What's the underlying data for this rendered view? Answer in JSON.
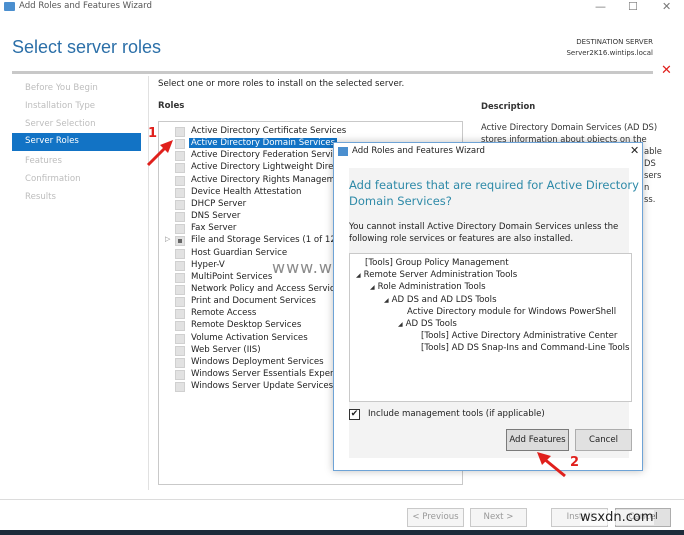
{
  "window": {
    "title": "Add Roles and Features Wizard",
    "minimize": "—",
    "maximize": "☐",
    "close": "✕"
  },
  "header": {
    "title": "Select server roles",
    "dest_label": "DESTINATION SERVER",
    "dest_server": "Server2K16.wintips.local",
    "error_icon": "✕"
  },
  "nav": {
    "items": [
      "Before You Begin",
      "Installation Type",
      "Server Selection",
      "Server Roles",
      "Features",
      "Confirmation",
      "Results"
    ],
    "selected": "Server Roles"
  },
  "main": {
    "instruction": "Select one or more roles to install on the selected server.",
    "roles_label": "Roles",
    "description_label": "Description",
    "description_lines": [
      "Active Directory Domain Services (AD DS)",
      "stores information about objects on the"
    ],
    "description_fragments": [
      "able",
      "DS",
      "sers",
      "n",
      "ss."
    ],
    "roles": [
      {
        "label": "Active Directory Certificate Services",
        "state": "unchecked"
      },
      {
        "label": "Active Directory Domain Services",
        "state": "unchecked",
        "selected": true
      },
      {
        "label": "Active Directory Federation Services",
        "state": "unchecked"
      },
      {
        "label": "Active Directory Lightweight Directory Services",
        "state": "unchecked"
      },
      {
        "label": "Active Directory Rights Management Services",
        "state": "unchecked"
      },
      {
        "label": "Device Health Attestation",
        "state": "unchecked"
      },
      {
        "label": "DHCP Server",
        "state": "unchecked"
      },
      {
        "label": "DNS Server",
        "state": "unchecked"
      },
      {
        "label": "Fax Server",
        "state": "unchecked"
      },
      {
        "label": "File and Storage Services (1 of 12 installed)",
        "state": "partial",
        "expandable": true
      },
      {
        "label": "Host Guardian Service",
        "state": "unchecked"
      },
      {
        "label": "Hyper-V",
        "state": "unchecked"
      },
      {
        "label": "MultiPoint Services",
        "state": "unchecked"
      },
      {
        "label": "Network Policy and Access Services",
        "state": "unchecked"
      },
      {
        "label": "Print and Document Services",
        "state": "unchecked"
      },
      {
        "label": "Remote Access",
        "state": "unchecked"
      },
      {
        "label": "Remote Desktop Services",
        "state": "unchecked"
      },
      {
        "label": "Volume Activation Services",
        "state": "unchecked"
      },
      {
        "label": "Web Server (IIS)",
        "state": "unchecked"
      },
      {
        "label": "Windows Deployment Services",
        "state": "unchecked"
      },
      {
        "label": "Windows Server Essentials Experience",
        "state": "unchecked"
      },
      {
        "label": "Windows Server Update Services",
        "state": "unchecked"
      }
    ]
  },
  "dialog": {
    "title": "Add Roles and Features Wizard",
    "close": "✕",
    "heading": [
      "Add features that are required for Active Directory",
      "Domain Services?"
    ],
    "body": [
      "You cannot install Active Directory Domain Services unless the",
      "following role services or features are also installed."
    ],
    "tree": [
      {
        "label": "[Tools] Group Policy Management",
        "level": 0,
        "expanded": false
      },
      {
        "label": "Remote Server Administration Tools",
        "level": 0,
        "expanded": true
      },
      {
        "label": "Role Administration Tools",
        "level": 1,
        "expanded": true
      },
      {
        "label": "AD DS and AD LDS Tools",
        "level": 2,
        "expanded": true
      },
      {
        "label": "Active Directory module for Windows PowerShell",
        "level": 3,
        "expanded": false
      },
      {
        "label": "AD DS Tools",
        "level": 3,
        "expanded": true,
        "collapsible": true
      },
      {
        "label": "[Tools] Active Directory Administrative Center",
        "level": 4,
        "expanded": false
      },
      {
        "label": "[Tools] AD DS Snap-Ins and Command-Line Tools",
        "level": 4,
        "expanded": false
      }
    ],
    "include_tools_label": "Include management tools (if applicable)",
    "include_tools_checked": true,
    "add_features": "Add Features",
    "cancel": "Cancel"
  },
  "footer": {
    "previous": "< Previous",
    "next": "Next >",
    "install": "Install",
    "cancel": "Cancel"
  },
  "annotations": {
    "step1": "1",
    "step2": "2",
    "color": "#e0201c"
  },
  "watermarks": {
    "center": "www.wintips.org",
    "corner": "wsxdn.com"
  },
  "colors": {
    "accent": "#1273c5",
    "heading": "#2e8aa8"
  }
}
